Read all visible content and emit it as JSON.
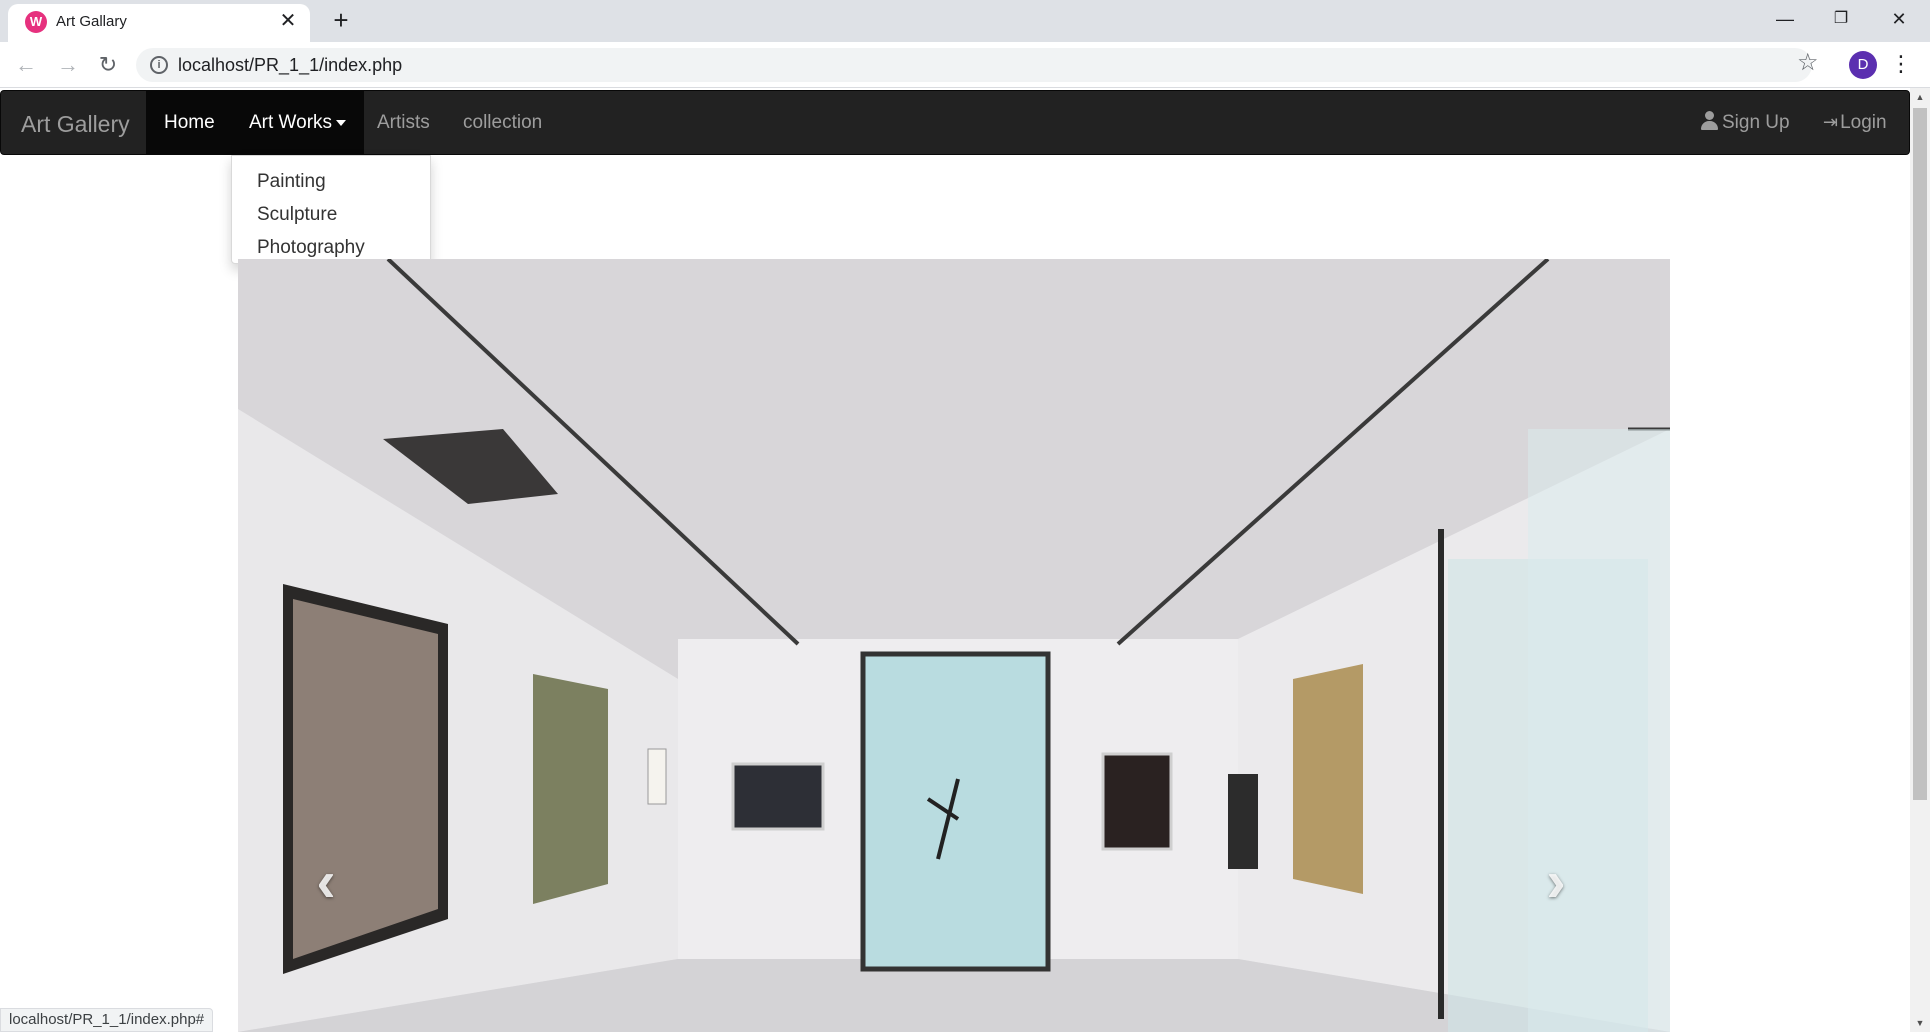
{
  "browser": {
    "tab_title": "Art Gallary",
    "favicon_letter": "W",
    "url": "localhost/PR_1_1/index.php",
    "profile_initial": "D",
    "status_url": "localhost/PR_1_1/index.php#"
  },
  "navbar": {
    "brand": "Art Gallery",
    "items": [
      {
        "label": "Home"
      },
      {
        "label": "Art Works"
      },
      {
        "label": "Artists"
      },
      {
        "label": "collection"
      }
    ],
    "right": {
      "signup": "Sign Up",
      "login": "Login"
    }
  },
  "dropdown": {
    "items": [
      "Painting",
      "Sculpture",
      "Photography"
    ]
  },
  "carousel": {
    "prev_glyph": "‹",
    "next_glyph": "›"
  },
  "colors": {
    "navbar_bg": "#222222",
    "navbar_active_bg": "#080808",
    "navbar_text": "#9d9d9d",
    "favicon": "#e6317e",
    "avatar": "#5b2fb0"
  }
}
